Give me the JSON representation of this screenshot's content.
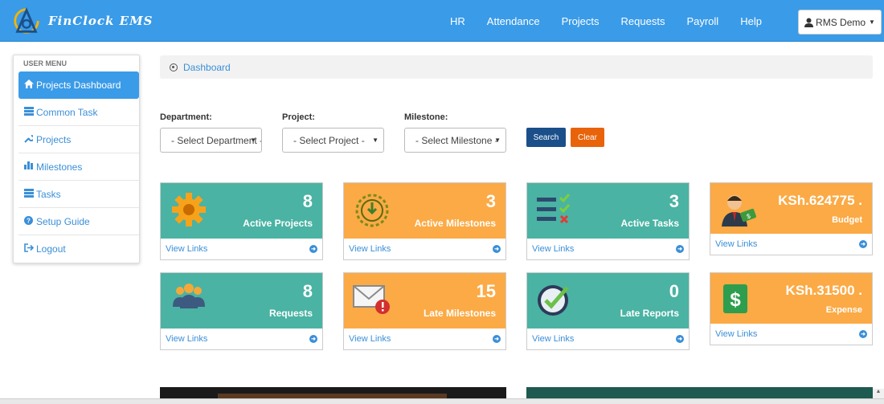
{
  "app": {
    "name": "FinClock EMS"
  },
  "nav": {
    "items": [
      "HR",
      "Attendance",
      "Projects",
      "Requests",
      "Payroll",
      "Help"
    ]
  },
  "user": {
    "label": "RMS Demo"
  },
  "sidebar": {
    "title": "USER MENU",
    "items": [
      {
        "label": "Projects Dashboard",
        "icon": "home-icon"
      },
      {
        "label": "Common Task",
        "icon": "list-icon"
      },
      {
        "label": "Projects",
        "icon": "wrench-icon"
      },
      {
        "label": "Milestones",
        "icon": "bar-chart-icon"
      },
      {
        "label": "Tasks",
        "icon": "tasks-icon"
      },
      {
        "label": "Setup Guide",
        "icon": "question-icon"
      },
      {
        "label": "Logout",
        "icon": "logout-icon"
      }
    ]
  },
  "breadcrumb": {
    "label": "Dashboard"
  },
  "filters": {
    "department": {
      "label": "Department:",
      "value": "- Select Department -"
    },
    "project": {
      "label": "Project:",
      "value": "- Select Project -"
    },
    "milestone": {
      "label": "Milestone:",
      "value": "- Select Milestone -"
    },
    "search_label": "Search",
    "clear_label": "Clear"
  },
  "cards": [
    {
      "value": "8",
      "label": "Active Projects",
      "link": "View Links",
      "color": "#4ab3a3",
      "icon": "gear-icon"
    },
    {
      "value": "3",
      "label": "Active Milestones",
      "link": "View Links",
      "color": "#fbaa45",
      "icon": "timer-icon"
    },
    {
      "value": "3",
      "label": "Active Tasks",
      "link": "View Links",
      "color": "#4ab3a3",
      "icon": "checklist-icon"
    },
    {
      "value": "KSh.624775 .",
      "label": "Budget",
      "link": "View Links",
      "color": "#fbaa45",
      "icon": "businessman-money-icon"
    },
    {
      "value": "8",
      "label": "Requests",
      "link": "View Links",
      "color": "#4ab3a3",
      "icon": "people-icon"
    },
    {
      "value": "15",
      "label": "Late Milestones",
      "link": "View Links",
      "color": "#fbaa45",
      "icon": "mail-alert-icon"
    },
    {
      "value": "0",
      "label": "Late Reports",
      "link": "View Links",
      "color": "#4ab3a3",
      "icon": "clock-check-icon"
    },
    {
      "value": "KSh.31500 .",
      "label": "Expense",
      "link": "View Links",
      "color": "#fbaa45",
      "icon": "dollar-icon"
    }
  ],
  "colors": {
    "header": "#3a9be8",
    "teal": "#4ab3a3",
    "orange": "#fbaa45",
    "search_button": "#1a4f8a",
    "clear_button": "#e8630a"
  }
}
